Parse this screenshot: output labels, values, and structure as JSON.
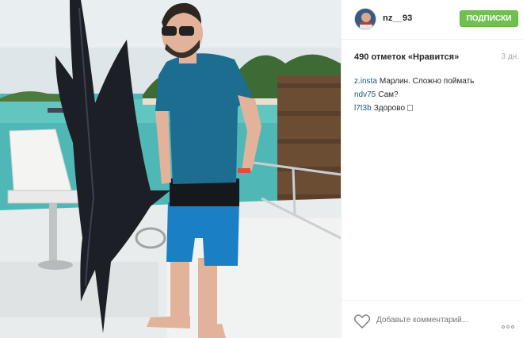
{
  "post": {
    "photo_alt": "",
    "user": {
      "username": "nz__93"
    },
    "follow_label": "ПОДПИСКИ",
    "likes_count": "490",
    "likes_label": "отметок «Нравится»",
    "time_ago": "3 дн.",
    "comments": [
      {
        "author": "z.insta",
        "text": "Марлин. Сложно поймать",
        "emoji": false
      },
      {
        "author": "ndv75",
        "text": "Сам?",
        "emoji": false
      },
      {
        "author": "l7t3b",
        "text": "Здорово",
        "emoji": true
      }
    ],
    "add_comment_placeholder": "Добавьте комментарий..."
  },
  "icons": {
    "like": "heart-outline-icon",
    "more": "more-options-icon"
  },
  "colors": {
    "follow_button": "#70c050",
    "username_link": "#125688",
    "muted": "#a5a7aa"
  }
}
